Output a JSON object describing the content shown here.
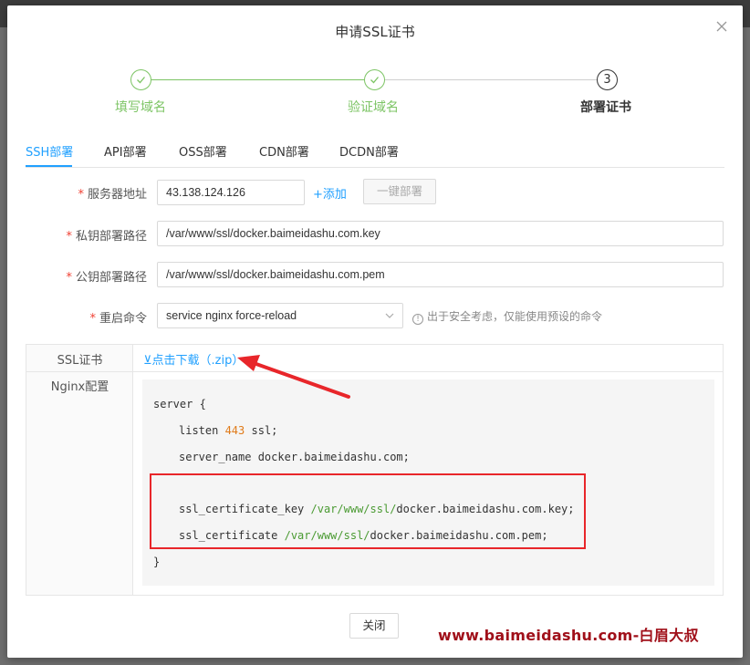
{
  "dialog": {
    "title": "申请SSL证书",
    "close_icon": "close-icon"
  },
  "steps": [
    {
      "label": "填写域名",
      "status": "done"
    },
    {
      "label": "验证域名",
      "status": "done"
    },
    {
      "label": "部署证书",
      "status": "current",
      "number": "3"
    }
  ],
  "tabs": [
    {
      "label": "SSH部署",
      "active": true
    },
    {
      "label": "API部署",
      "active": false
    },
    {
      "label": "OSS部署",
      "active": false
    },
    {
      "label": "CDN部署",
      "active": false
    },
    {
      "label": "DCDN部署",
      "active": false
    }
  ],
  "form": {
    "server": {
      "label": "服务器地址",
      "value": "43.138.124.126",
      "add_label": "+添加",
      "deploy_label": "一键部署"
    },
    "key_path": {
      "label": "私钥部署路径",
      "value": "/var/www/ssl/docker.baimeidashu.com.key"
    },
    "pem_path": {
      "label": "公钥部署路径",
      "value": "/var/www/ssl/docker.baimeidashu.com.pem"
    },
    "restart": {
      "label": "重启命令",
      "value": "service nginx force-reload",
      "hint": "出于安全考虑，仅能使用预设的命令"
    }
  },
  "info": {
    "ssl_label": "SSL证书",
    "download_label": "⊻点击下载（.zip）",
    "nginx_label": "Nginx配置",
    "code": {
      "l1": "server {",
      "l2_a": "listen ",
      "l2_num": "443",
      "l2_b": " ssl;",
      "l3": "server_name docker.baimeidashu.com;",
      "l4_a": "ssl_certificate_key ",
      "l4_path": "/var/www/ssl/",
      "l4_b": "docker.baimeidashu.com.key;",
      "l5_a": "ssl_certificate ",
      "l5_path": "/var/www/ssl/",
      "l5_b": "docker.baimeidashu.com.pem;",
      "l6": "}"
    }
  },
  "footer": {
    "close_label": "关闭"
  },
  "watermark": "www.baimeidashu.com-白眉大叔",
  "colors": {
    "accent": "#20a0ff",
    "success": "#7cc464",
    "required": "#f04134",
    "annotation": "#e8262a",
    "watermark": "#a0101a"
  }
}
